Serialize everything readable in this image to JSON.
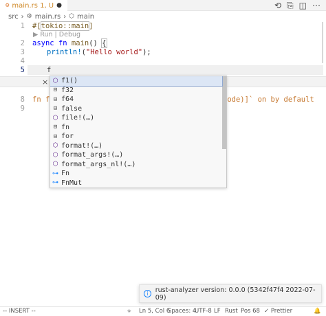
{
  "tab": {
    "label": "main.rs 1, U",
    "dirty_marker": "●"
  },
  "breadcrumb": {
    "items": [
      "src",
      "main.rs",
      "main"
    ],
    "separator": "›"
  },
  "editor": {
    "line_numbers": [
      "1",
      "2",
      "3",
      "4",
      "5",
      "",
      "8",
      "9"
    ],
    "codelens": "▶ Run | Debug",
    "line1": {
      "p1": "#[",
      "p2": "tokio::main",
      "p3": "]"
    },
    "line2": {
      "kw": "async fn ",
      "name": "main",
      "rest": "() ",
      "brace": "{"
    },
    "line3": {
      "macro": "println!",
      "open": "(",
      "str": "\"Hello world\"",
      "close": ");"
    },
    "line5": "f",
    "line8_head": "fn f",
    "line8_tail": "node)]` on by default"
  },
  "suggest": {
    "close": "×",
    "items": [
      {
        "icon": "⬡",
        "kind": "method",
        "label": "f1()"
      },
      {
        "icon": "⊟",
        "kind": "keyword",
        "label": "f32"
      },
      {
        "icon": "⊟",
        "kind": "keyword",
        "label": "f64"
      },
      {
        "icon": "⊟",
        "kind": "keyword",
        "label": "false"
      },
      {
        "icon": "⬡",
        "kind": "method",
        "label": "file!(…)"
      },
      {
        "icon": "⊟",
        "kind": "keyword",
        "label": "fn"
      },
      {
        "icon": "⊟",
        "kind": "keyword",
        "label": "for"
      },
      {
        "icon": "⬡",
        "kind": "method",
        "label": "format!(…)"
      },
      {
        "icon": "⬡",
        "kind": "method",
        "label": "format_args!(…)"
      },
      {
        "icon": "⬡",
        "kind": "method",
        "label": "format_args_nl!(…)"
      },
      {
        "icon": "⊶",
        "kind": "struct",
        "label": "Fn"
      },
      {
        "icon": "⊶",
        "kind": "struct",
        "label": "FnMut"
      }
    ]
  },
  "notification": {
    "icon": "i",
    "text": "rust-analyzer version: 0.0.0 (5342f47f4 2022-07-09)"
  },
  "statusbar": {
    "mode": "-- INSERT --",
    "sync_icon": "⟡",
    "position": "Ln 5, Col 6",
    "spaces": "Spaces: 4",
    "encoding": "UTF-8",
    "eol": "LF",
    "language": "Rust",
    "pos": "Pos 68",
    "prettier": "✓ Prettier",
    "bell_icon": "🔔"
  },
  "colors": {
    "accent": "#0b216f",
    "selection": "#dce6f5",
    "warning": "#c6772e"
  }
}
